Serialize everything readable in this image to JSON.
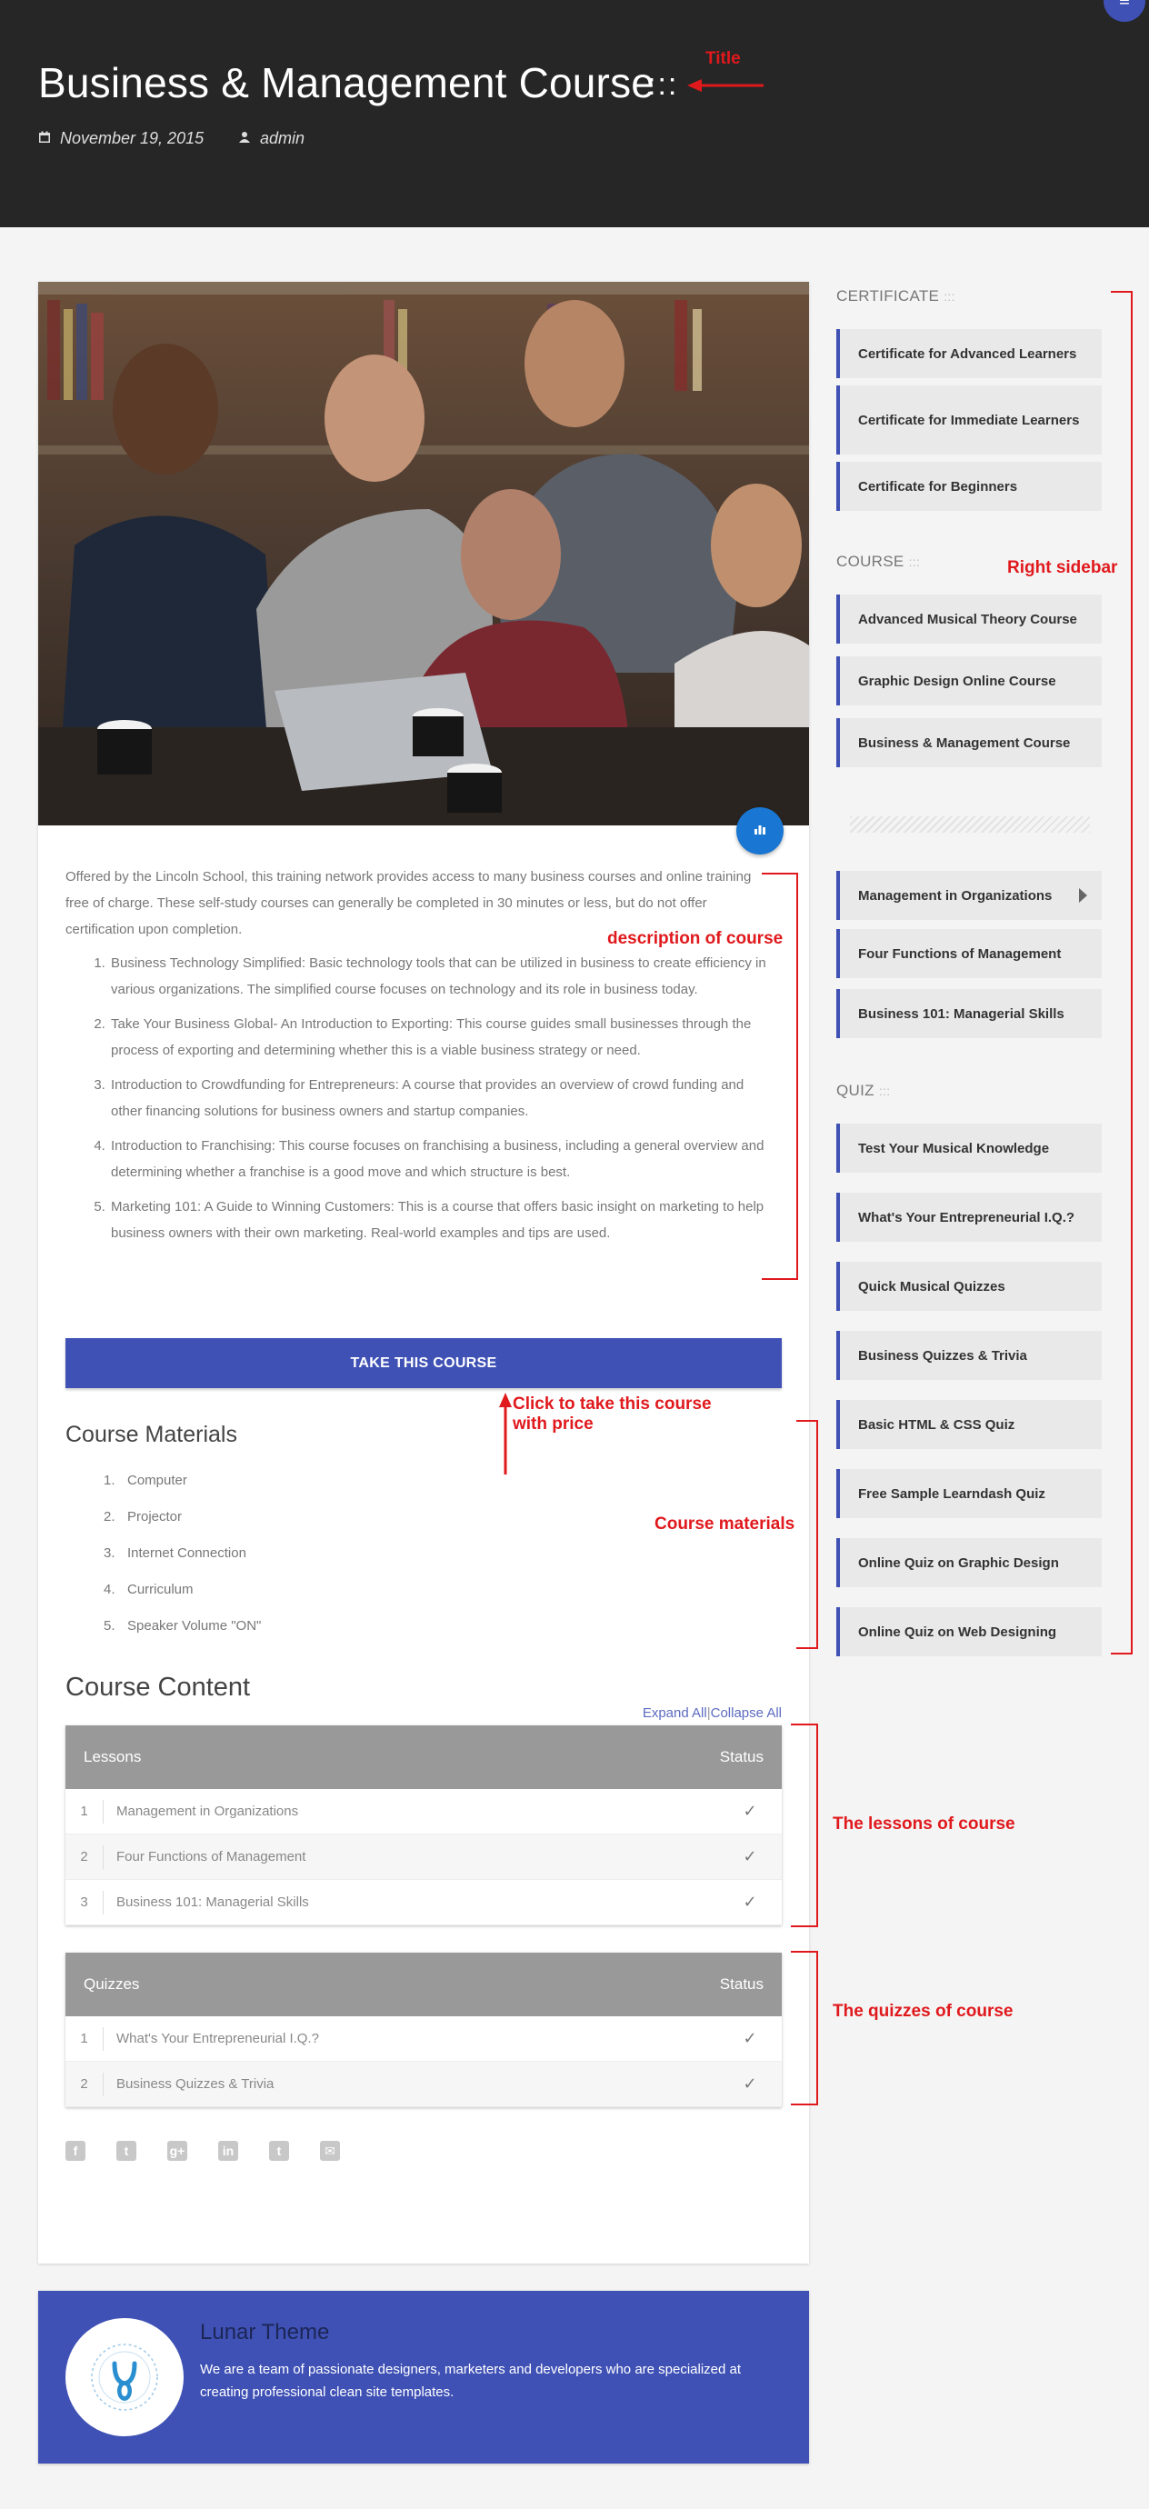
{
  "header": {
    "title": "Business & Management Course",
    "separator": ":::",
    "date": "November 19, 2015",
    "author": "admin"
  },
  "annotations": {
    "title": "Title",
    "right_sidebar": "Right sidebar",
    "description": "description of course",
    "take_course": "Click to take this course\nwith price",
    "materials": "Course materials",
    "lessons": "The lessons of course",
    "quizzes": "The quizzes of course"
  },
  "course": {
    "intro": "Offered by the Lincoln School, this training network provides access to many business courses and online training free of charge. These self-study courses can generally be completed in 30 minutes or less, but do not offer certification upon completion.",
    "items": [
      "Business Technology Simplified: Basic technology tools that can be utilized in business to create efficiency in various organizations. The simplified course focuses on technology and its role in business today.",
      "Take Your Business Global- An Introduction to Exporting: This course guides small businesses through the process of exporting and determining whether this is a viable business strategy or need.",
      "Introduction to Crowdfunding for Entrepreneurs: A course that provides an overview of crowd funding and other financing solutions for business owners and startup companies.",
      "Introduction to Franchising: This course focuses on franchising a business, including a general overview and determining whether a franchise is a good move and which structure is best.",
      "Marketing 101: A Guide to Winning Customers: This is a course that offers basic insight on marketing to help business owners with their own marketing. Real-world examples and tips are used."
    ],
    "take_button": "TAKE THIS COURSE",
    "materials_title": "Course Materials",
    "materials": [
      "Computer",
      "Projector",
      "Internet Connection",
      "Curriculum",
      "Speaker Volume \"ON\""
    ],
    "content_title": "Course Content",
    "expand_all": "Expand All",
    "collapse_all": "Collapse All",
    "lessons_header": "Lessons",
    "quizzes_header": "Quizzes",
    "status_header": "Status",
    "lessons": [
      "Management in Organizations",
      "Four Functions of Management",
      "Business 101: Managerial Skills"
    ],
    "quizzes": [
      "What's Your Entrepreneurial I.Q.?",
      "Business Quizzes & Trivia"
    ],
    "status_mark": "✓"
  },
  "social": [
    "f",
    "t",
    "g+",
    "in",
    "t",
    "✉"
  ],
  "author_box": {
    "name": "Lunar Theme",
    "bio": "We are a team of passionate designers, marketers and developers who are specialized at creating professional clean site templates."
  },
  "sidebar": {
    "certificate_title": "CERTIFICATE",
    "course_title": "COURSE",
    "quiz_title": "QUIZ",
    "title_sep": ":::",
    "certificates": [
      "Certificate for Advanced Learners",
      "Certificate for Immediate Learners",
      "Certificate for Beginners"
    ],
    "courses": [
      "Advanced Musical Theory Course",
      "Graphic Design Online Course",
      "Business & Management Course"
    ],
    "lessons": [
      "Management in Organizations",
      "Four Functions of Management",
      "Business 101: Managerial Skills"
    ],
    "quizzes": [
      "Test Your Musical Knowledge",
      "What's Your Entrepreneurial I.Q.?",
      "Quick Musical Quizzes",
      "Business Quizzes & Trivia",
      "Basic HTML & CSS Quiz",
      "Free Sample Learndash Quiz",
      "Online Quiz on Graphic Design",
      "Online Quiz on Web Designing"
    ]
  },
  "colors": {
    "accent": "#3f51b5",
    "header_bg": "#262626",
    "annotation": "#e0191d"
  }
}
